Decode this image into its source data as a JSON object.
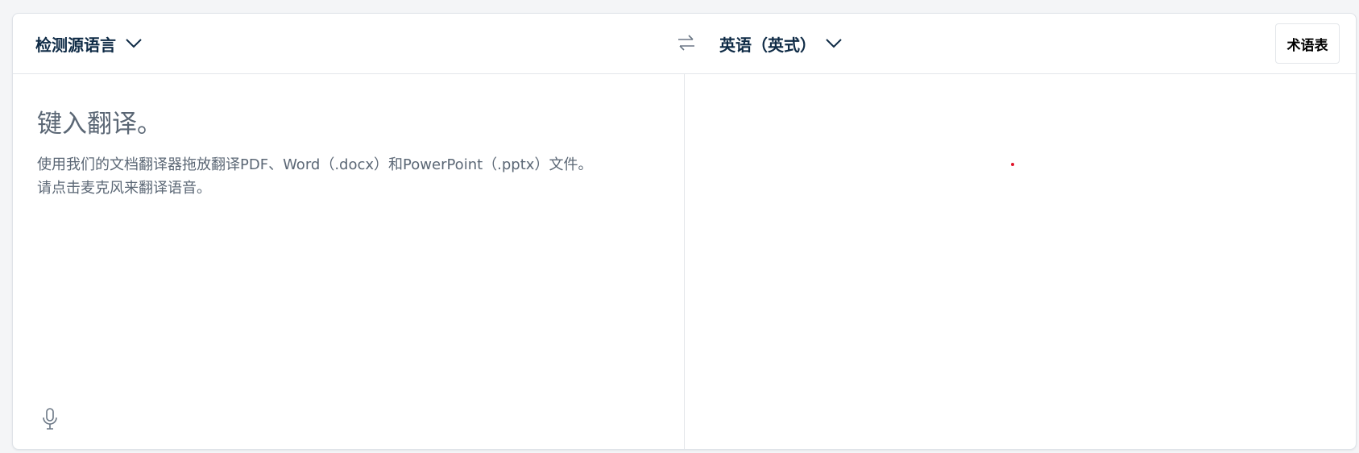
{
  "header": {
    "source_lang": "检测源语言",
    "target_lang": "英语（英式）",
    "glossary_label": "术语表"
  },
  "icons": {
    "source_chevron": "chevron-down-icon",
    "target_chevron": "chevron-down-icon",
    "swap": "swap-arrows-icon",
    "mic": "microphone-icon"
  },
  "source_pane": {
    "placeholder": "键入翻译。",
    "hint_line1": "使用我们的文档翻译器拖放翻译PDF、Word（.docx）和PowerPoint（.pptx）文件。",
    "hint_line2": "请点击麦克风来翻译语音。"
  },
  "colors": {
    "text_dark": "#0f2b46",
    "text_muted": "#5b6775",
    "border": "#e3e6ea",
    "cursor_dot": "#e0142a"
  }
}
